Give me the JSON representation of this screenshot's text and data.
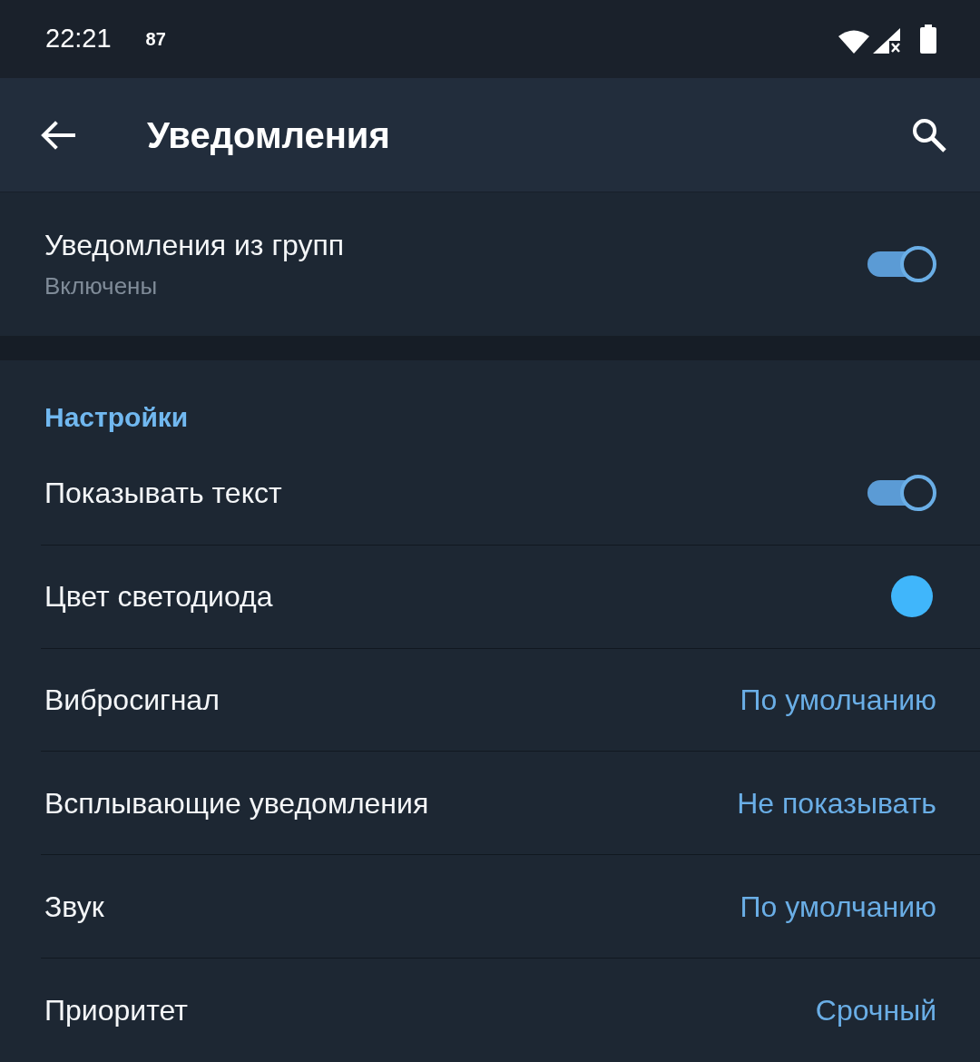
{
  "status_bar": {
    "time": "22:21",
    "extra_text": "87"
  },
  "app_bar": {
    "title": "Уведомления"
  },
  "group_notifications": {
    "title": "Уведомления из групп",
    "subtitle": "Включены",
    "on": true
  },
  "settings": {
    "header": "Настройки",
    "items": [
      {
        "kind": "toggle",
        "label": "Показывать текст",
        "on": true
      },
      {
        "kind": "color",
        "label": "Цвет светодиода",
        "color": "#40b6fb"
      },
      {
        "kind": "value",
        "label": "Вибросигнал",
        "value": "По умолчанию"
      },
      {
        "kind": "value",
        "label": "Всплывающие уведомления",
        "value": "Не показывать"
      },
      {
        "kind": "value",
        "label": "Звук",
        "value": "По умолчанию"
      },
      {
        "kind": "value",
        "label": "Приоритет",
        "value": "Срочный"
      }
    ]
  }
}
